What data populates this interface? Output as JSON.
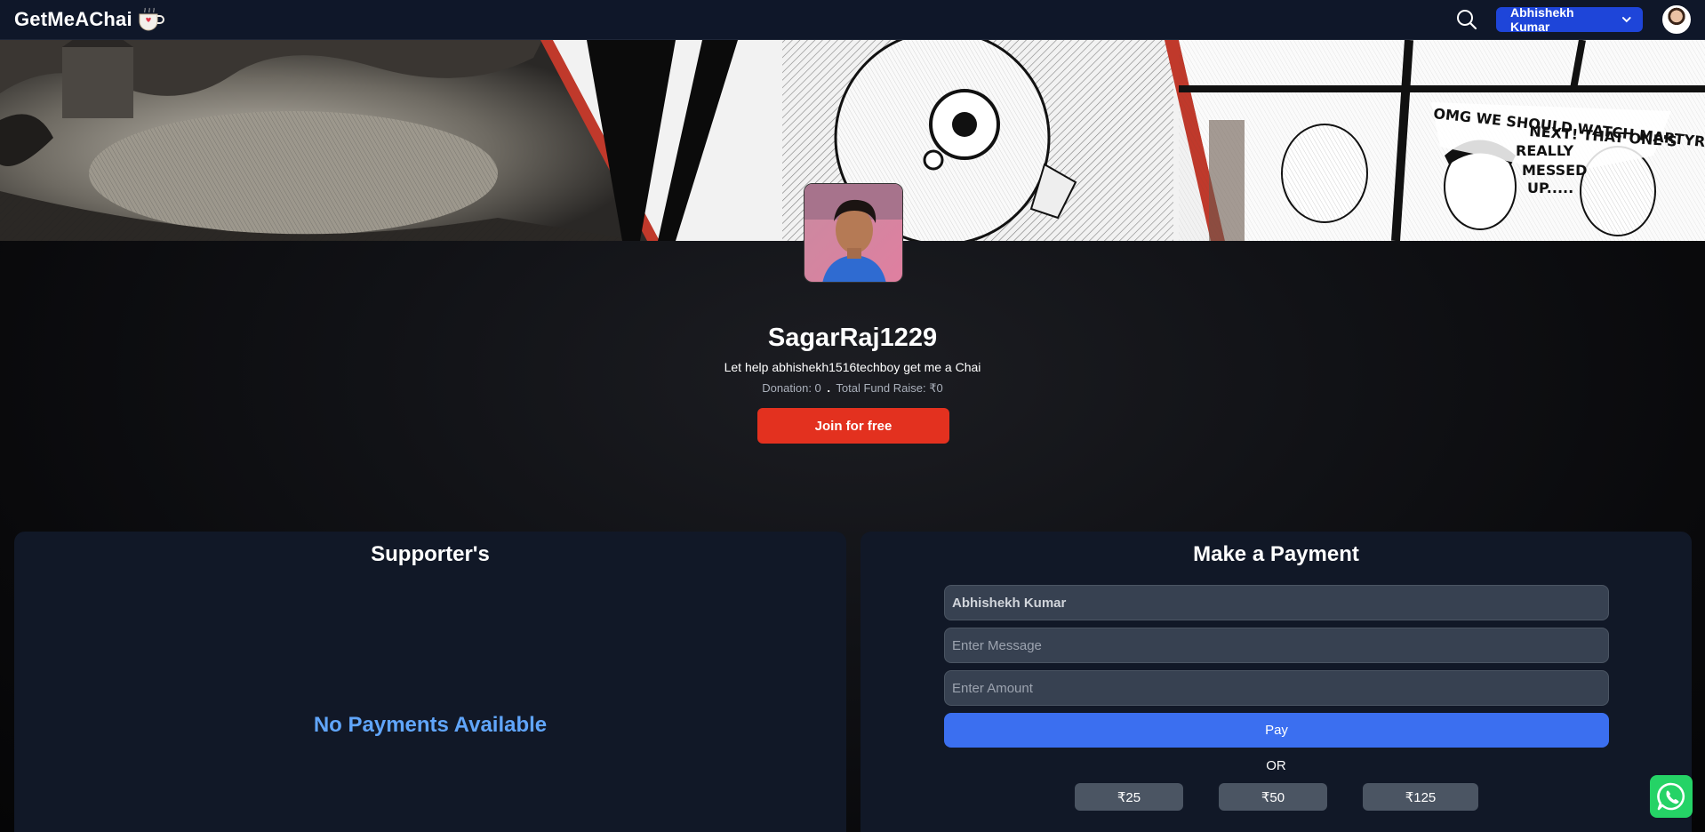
{
  "navbar": {
    "brand": "GetMeAChai",
    "user_name": "Abhishekh Kumar"
  },
  "profile": {
    "username": "SagarRaj1229",
    "tagline": "Let help abhishekh1516techboy get me a Chai",
    "donation_label": "Donation: 0",
    "dot": ".",
    "fund_label": "Total Fund Raise: ₹0",
    "join_label": "Join for free"
  },
  "supporters": {
    "title": "Supporter's",
    "empty_message": "No Payments Available"
  },
  "payment": {
    "title": "Make a Payment",
    "name_value": "Abhishekh Kumar",
    "message_placeholder": "Enter Message",
    "amount_placeholder": "Enter Amount",
    "pay_label": "Pay",
    "or_label": "OR",
    "quick_amounts": [
      "₹25",
      "₹50",
      "₹125"
    ]
  },
  "colors": {
    "navbar_bg": "#0f1729",
    "user_button": "#1e45d9",
    "join_button": "#e3311f",
    "pay_button": "#3b6ff0",
    "empty_text": "#60a5fa",
    "panel_bg": "#111827"
  },
  "icons": [
    "chai-cup-icon",
    "search-icon",
    "chevron-down-icon",
    "whatsapp-icon"
  ]
}
